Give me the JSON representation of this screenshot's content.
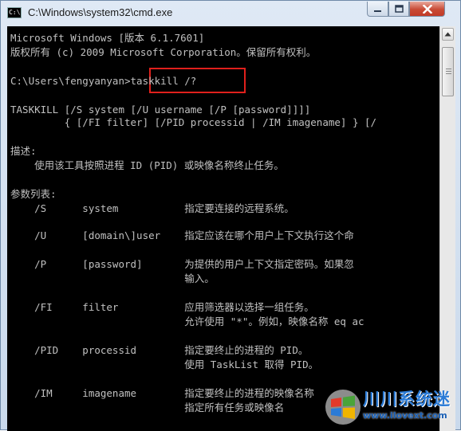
{
  "window": {
    "title": "C:\\Windows\\system32\\cmd.exe",
    "icon_glyph": "C:\\",
    "buttons": {
      "minimize": "minimize-icon",
      "maximize": "maximize-icon",
      "close": "close-icon"
    }
  },
  "console": {
    "lines": [
      "Microsoft Windows [版本 6.1.7601]",
      "版权所有 (c) 2009 Microsoft Corporation。保留所有权利。",
      "",
      "C:\\Users\\fengyanyan>taskkill /?",
      "",
      "TASKKILL [/S system [/U username [/P [password]]]]",
      "         { [/FI filter] [/PID processid | /IM imagename] } [/",
      "",
      "描述:",
      "    使用该工具按照进程 ID (PID) 或映像名称终止任务。",
      "",
      "参数列表:",
      "    /S      system           指定要连接的远程系统。",
      "",
      "    /U      [domain\\]user    指定应该在哪个用户上下文执行这个命",
      "",
      "    /P      [password]       为提供的用户上下文指定密码。如果忽",
      "                             输入。",
      "",
      "    /FI     filter           应用筛选器以选择一组任务。",
      "                             允许使用 \"*\"。例如，映像名称 eq ac",
      "",
      "    /PID    processid        指定要终止的进程的 PID。",
      "                             使用 TaskList 取得 PID。",
      "",
      "    /IM     imagename        指定要终止的进程的映像名称",
      "                             指定所有任务或映像名"
    ],
    "text_color": "#c0c0c0",
    "background": "#000000",
    "highlight_color": "#e0201c"
  },
  "watermark": {
    "name": "川川系统迷",
    "url": "www.ilovext.com",
    "color": "#2b7bd6"
  }
}
